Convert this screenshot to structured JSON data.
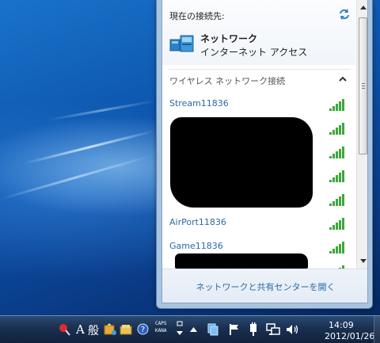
{
  "flyout": {
    "current_connection_label": "現在の接続先:",
    "network_name": "ネットワーク",
    "network_status": "インターネット アクセス",
    "wireless_section_label": "ワイヤレス ネットワーク接続",
    "networks": [
      {
        "name": "Stream11836",
        "icon": "signal-strength-icon"
      },
      {
        "name": "",
        "icon": "signal-strength-icon"
      },
      {
        "name": "",
        "icon": "signal-strength-icon"
      },
      {
        "name": "",
        "icon": "signal-strength-icon"
      },
      {
        "name": "",
        "icon": "signal-strength-icon"
      },
      {
        "name": "AirPort11836",
        "icon": "signal-strength-icon"
      },
      {
        "name": "Game11836",
        "icon": "signal-strength-icon"
      },
      {
        "name": "",
        "icon": "signal-strength-icon"
      }
    ],
    "footer_link": "ネットワークと共有センターを開く"
  },
  "taskbar": {
    "ime_mode": "A",
    "ime_kanji": "般",
    "caps_label": "CAPS",
    "kana_label": "KANA",
    "clock_time": "14:09",
    "clock_date": "2012/01/26"
  },
  "colors": {
    "link_blue": "#2a6aa8",
    "signal_green": "#3da83d",
    "taskbar_dark": "#1a3050"
  }
}
